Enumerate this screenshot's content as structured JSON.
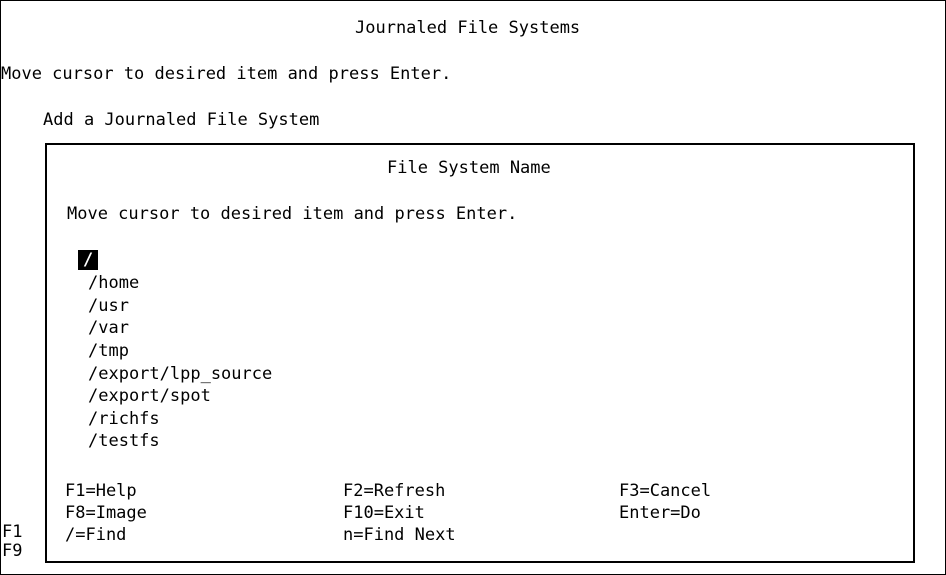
{
  "screen": {
    "title": "Journaled File Systems",
    "instruction": "Move cursor to desired item and press Enter.",
    "menu_item": "Add a Journaled File System",
    "left_keys": [
      "F1",
      "F9"
    ]
  },
  "popup": {
    "title": "File System Name",
    "instruction": "Move cursor to desired item and press Enter.",
    "selected_item": "/",
    "items": [
      "/home",
      "/usr",
      "/var",
      "/tmp",
      "/export/lpp_source",
      "/export/spot",
      "/richfs",
      "/testfs"
    ],
    "function_keys": {
      "f1": "F1=Help",
      "f2": "F2=Refresh",
      "f3": "F3=Cancel",
      "f8": "F8=Image",
      "f10": "F10=Exit",
      "enter": "Enter=Do",
      "find": "/=Find",
      "find_next": "n=Find Next"
    }
  }
}
